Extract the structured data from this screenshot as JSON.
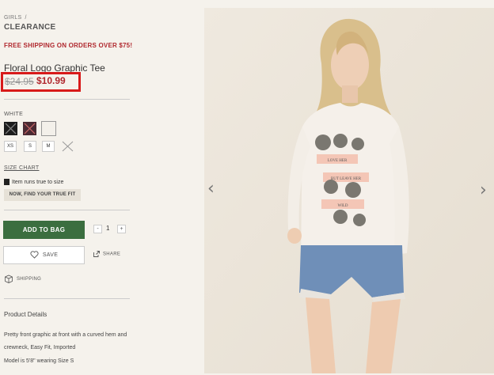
{
  "breadcrumb": {
    "parent": "GIRLS",
    "separator": "/",
    "current": "CLEARANCE"
  },
  "promo": {
    "free_shipping": "FREE SHIPPING ON ORDERS OVER $75!"
  },
  "product": {
    "title": "Floral Logo Graphic Tee",
    "old_price": "$24.95",
    "new_price": "$10.99",
    "color_label": "WHITE",
    "swatches": [
      {
        "name": "black",
        "color": "#1c1c1c",
        "available": false
      },
      {
        "name": "burgundy",
        "color": "#4a2a33",
        "available": false
      },
      {
        "name": "white",
        "color": "#f3f0ea",
        "available": true,
        "selected": true
      }
    ],
    "sizes": [
      {
        "label": "XS",
        "available": true
      },
      {
        "label": "S",
        "available": true
      },
      {
        "label": "M",
        "available": true
      },
      {
        "label": "L",
        "available": false
      }
    ],
    "size_chart_label": "SIZE CHART",
    "fit_note": "Item runs true to size",
    "fit_button": "NOW, FIND YOUR TRUE FIT"
  },
  "actions": {
    "add_to_bag": "ADD TO BAG",
    "qty_minus": "-",
    "qty_value": "1",
    "qty_plus": "+",
    "save": "SAVE",
    "share": "SHARE",
    "shipping": "SHIPPING"
  },
  "details": {
    "title": "Product Details",
    "description": "Pretty front graphic at front with a curved hem and crewneck, Easy Fit, Imported",
    "model": "Model is 5'8\" wearing Size S"
  },
  "gallery": {
    "prev_icon": "‹",
    "next_icon": "›",
    "shirt_text": [
      "LOVE HER",
      "BUT LEAVE HER",
      "WILD"
    ]
  },
  "colors": {
    "sale_red": "#b0282e",
    "highlight_red": "#d81a1a",
    "bag_green": "#3b6e3f"
  }
}
